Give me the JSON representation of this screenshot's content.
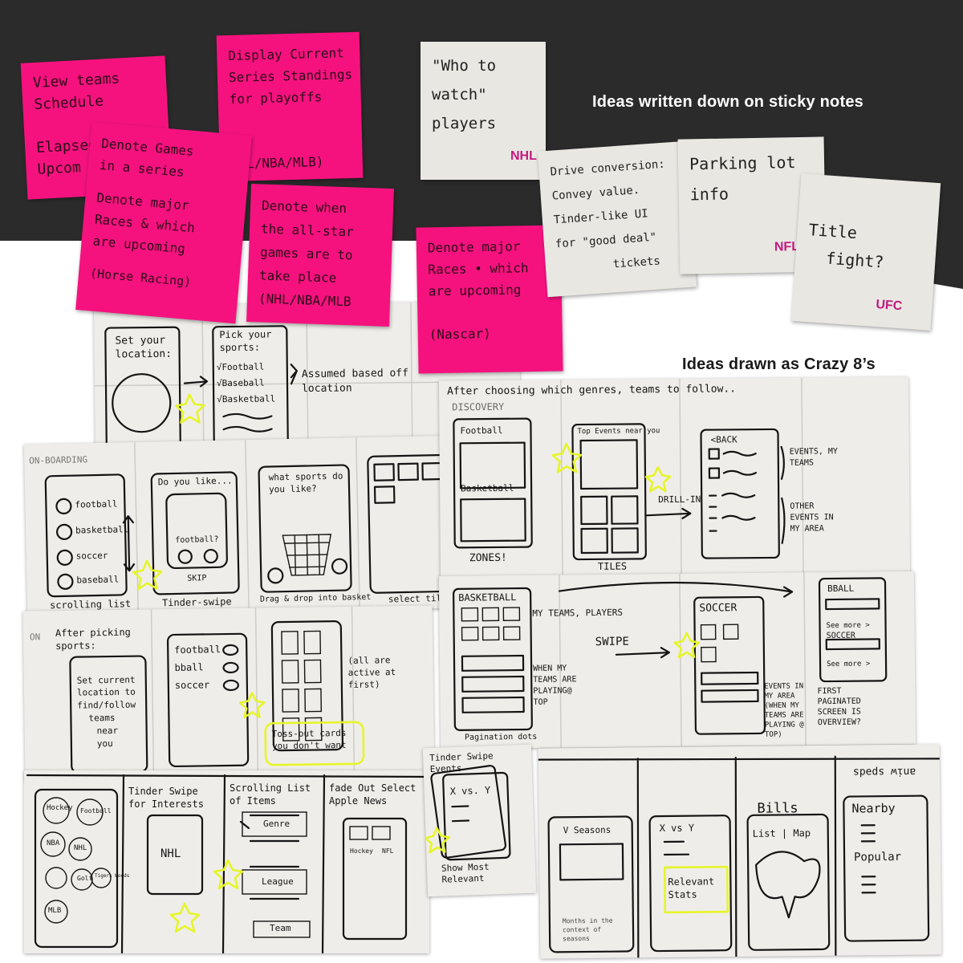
{
  "captions": {
    "sticky_notes": "Ideas written down on sticky notes",
    "crazy8": "Ideas drawn as Crazy 8’s"
  },
  "colors": {
    "dark_band": "#2b2b2b",
    "pink_note": "#f5127f",
    "grey_note": "#e9e7e2",
    "highlighter": "#e6f52a",
    "league_tag": "#c21a7f"
  },
  "sticky_notes": [
    {
      "id": "n1",
      "lines": [
        "View teams",
        "Schedule",
        "",
        "Elapsed /",
        "Upcom"
      ]
    },
    {
      "id": "n2",
      "lines": [
        "Display Current",
        "Series Standings",
        "for playoffs",
        "",
        "",
        "NHL/NBA/MLB)"
      ]
    },
    {
      "id": "n3",
      "lines": [
        "\"Who to",
        "watch\"",
        "players"
      ],
      "tag": "NHL"
    },
    {
      "id": "n4",
      "lines": [
        "Denote Games",
        "in a series",
        "",
        "Denote major",
        "Races & which",
        "are upcoming",
        "",
        "(Horse Racing)"
      ]
    },
    {
      "id": "n5",
      "lines": [
        "Denote when",
        "the all-star",
        "games are to",
        "take place",
        "(NHL/NBA/MLB"
      ]
    },
    {
      "id": "n6",
      "lines": [
        "Denote major",
        "Races • which",
        "are upcoming",
        "",
        "(Nascar)"
      ]
    },
    {
      "id": "n7",
      "lines": [
        "Drive conversion:",
        "Convey value.",
        "Tinder-like UI",
        "for \"good deal\"",
        "tickets"
      ]
    },
    {
      "id": "n8",
      "lines": [
        "Parking lot",
        "info"
      ],
      "tag": "NFL"
    },
    {
      "id": "n9",
      "lines": [
        "Title",
        "fight?"
      ],
      "tag": "UFC"
    }
  ],
  "sketches": {
    "location": {
      "s1": "Set your location:",
      "s2": "Pick your sports:",
      "checks": [
        "√Football",
        "√Baseball",
        "√Basketball"
      ],
      "note": "Assumed based off location"
    },
    "onboarding": {
      "label": "ON-BOARDING",
      "sports": [
        "football",
        "basketball",
        "soccer",
        "baseball"
      ],
      "cap1": "scrolling list",
      "do_you_like": "Do you like...",
      "football_q": "football?",
      "skip": "SKIP",
      "cap2": "Tinder-swipe",
      "what_sports": "what sports do you like?",
      "cap3": "Drag & drop into basket",
      "cap4": "select tile"
    },
    "after_picking": {
      "label": "ON",
      "title": "After picking sports:",
      "location_text": [
        "Set current",
        "location to",
        "find/follow",
        "teams",
        "near",
        "you"
      ],
      "toggles": [
        "football",
        "bball",
        "soccer"
      ],
      "note": "(all are active at first)",
      "toss": "Toss-out cards you don't want"
    },
    "discovery": {
      "header": "After choosing which genres, teams to follow..",
      "label": "DISCOVERY",
      "football": "Football",
      "basketball": "Basketball",
      "zones": "ZONES!",
      "top_events": "Top Events near you",
      "drill": "DRILL-IN",
      "tiles": "TILES",
      "back": "<BACK",
      "events_my": "EVENTS, MY TEAMS",
      "other_events": "OTHER EVENTS IN MY AREA"
    },
    "basketball": {
      "title": "BASKETBALL",
      "my_teams": "MY TEAMS, PLAYERS",
      "when": "WHEN MY TEAMS ARE PLAYING@ TOP",
      "dots": "Pagination dots",
      "swipe": "SWIPE",
      "soccer": "SOCCER",
      "events_area": "EVENTS IN MY AREA (WHEN MY TEAMS ARE PLAYING @ TOP)",
      "bball": "BBALL",
      "see_more": "See more >",
      "soccer2": "SOCCER",
      "first": "FIRST PAGINATED SCREEN IS OVERVIEW?"
    },
    "row_bottom": {
      "sports_bubbles": [
        "Hockey",
        "Football",
        "NBA",
        "NHL",
        "Golf",
        "Tigers Woods",
        "MLB"
      ],
      "tinder": "Tinder Swipe for Interests",
      "nhl": "NHL",
      "scroll": "Scrolling List of Items",
      "genre": "Genre",
      "league": "League",
      "team": "Team",
      "fade": "fade Out Select Apple News",
      "hockey": "Hockey",
      "nfl": "NFL"
    },
    "tinder_events": {
      "title": "Tinder Swipe Events",
      "xvy": "X vs. Y",
      "caption": "Show Most Relevant"
    },
    "seasons": {
      "seasons": "V Seasons",
      "months": "Months in the context of seasons",
      "xvy": "X vs Y",
      "stats": "Relevant Stats",
      "bills": "Bills",
      "list_map": "List | Map",
      "nearby": "Nearby",
      "popular": "Popular",
      "upside": "aniw spəds"
    }
  }
}
